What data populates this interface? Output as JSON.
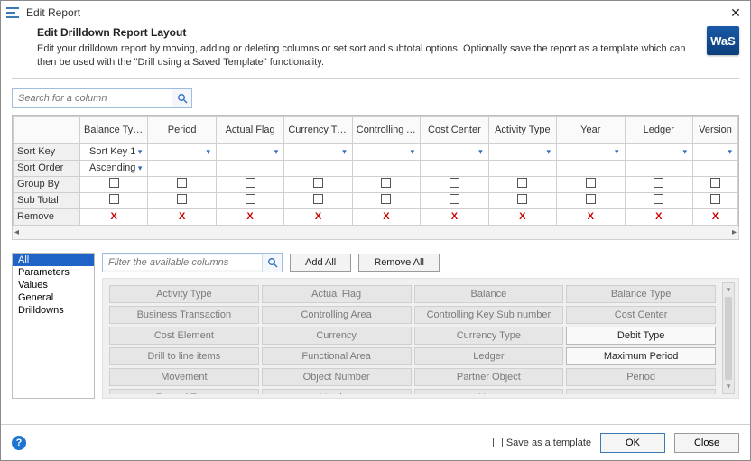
{
  "window": {
    "title": "Edit Report",
    "logo": "WaS"
  },
  "header": {
    "title": "Edit Drilldown Report Layout",
    "desc": "Edit your drilldown report by moving, adding or deleting columns or set sort and subtotal options. Optionally save the report as a template which can then be used with the \"Drill using a Saved Template\" functionality."
  },
  "searchColumn": {
    "placeholder": "Search for a column"
  },
  "grid": {
    "columns": [
      "Balance Type",
      "Period",
      "Actual Flag",
      "Currency Type",
      "Controlling Area",
      "Cost Center",
      "Activity Type",
      "Year",
      "Ledger",
      "Version"
    ],
    "rows": {
      "sortKey": {
        "label": "Sort Key",
        "values": [
          "Sort Key 1",
          "",
          "",
          "",
          "",
          "",
          "",
          "",
          "",
          ""
        ]
      },
      "sortOrder": {
        "label": "Sort Order",
        "values": [
          "Ascending",
          "",
          "",
          "",
          "",
          "",
          "",
          "",
          "",
          ""
        ]
      },
      "groupBy": {
        "label": "Group By"
      },
      "subTotal": {
        "label": "Sub Total"
      },
      "remove": {
        "label": "Remove",
        "glyph": "X"
      }
    }
  },
  "categories": {
    "items": [
      "All",
      "Parameters",
      "Values",
      "General",
      "Drilldowns"
    ],
    "selectedIndex": 0
  },
  "filter": {
    "placeholder": "Filter the available columns"
  },
  "buttons": {
    "addAll": "Add All",
    "removeAll": "Remove All",
    "ok": "OK",
    "close": "Close"
  },
  "chips": [
    {
      "label": "Activity Type",
      "enabled": false
    },
    {
      "label": "Actual Flag",
      "enabled": false
    },
    {
      "label": "Balance",
      "enabled": false
    },
    {
      "label": "Balance Type",
      "enabled": false
    },
    {
      "label": "Business Transaction",
      "enabled": false
    },
    {
      "label": "Controlling Area",
      "enabled": false
    },
    {
      "label": "Controlling Key Sub number",
      "enabled": false
    },
    {
      "label": "Cost Center",
      "enabled": false
    },
    {
      "label": "Cost Element",
      "enabled": false
    },
    {
      "label": "Currency",
      "enabled": false
    },
    {
      "label": "Currency Type",
      "enabled": false
    },
    {
      "label": "Debit Type",
      "enabled": true
    },
    {
      "label": "Drill to line items",
      "enabled": false
    },
    {
      "label": "Functional Area",
      "enabled": false
    },
    {
      "label": "Ledger",
      "enabled": false
    },
    {
      "label": "Maximum Period",
      "enabled": true
    },
    {
      "label": "Movement",
      "enabled": false
    },
    {
      "label": "Object Number",
      "enabled": false
    },
    {
      "label": "Partner Object",
      "enabled": false
    },
    {
      "label": "Period",
      "enabled": false
    },
    {
      "label": "Record Type",
      "enabled": false
    },
    {
      "label": "Version",
      "enabled": false
    },
    {
      "label": "Year",
      "enabled": false
    },
    {
      "label": "",
      "enabled": false
    }
  ],
  "footer": {
    "saveTemplate": "Save as a template"
  }
}
